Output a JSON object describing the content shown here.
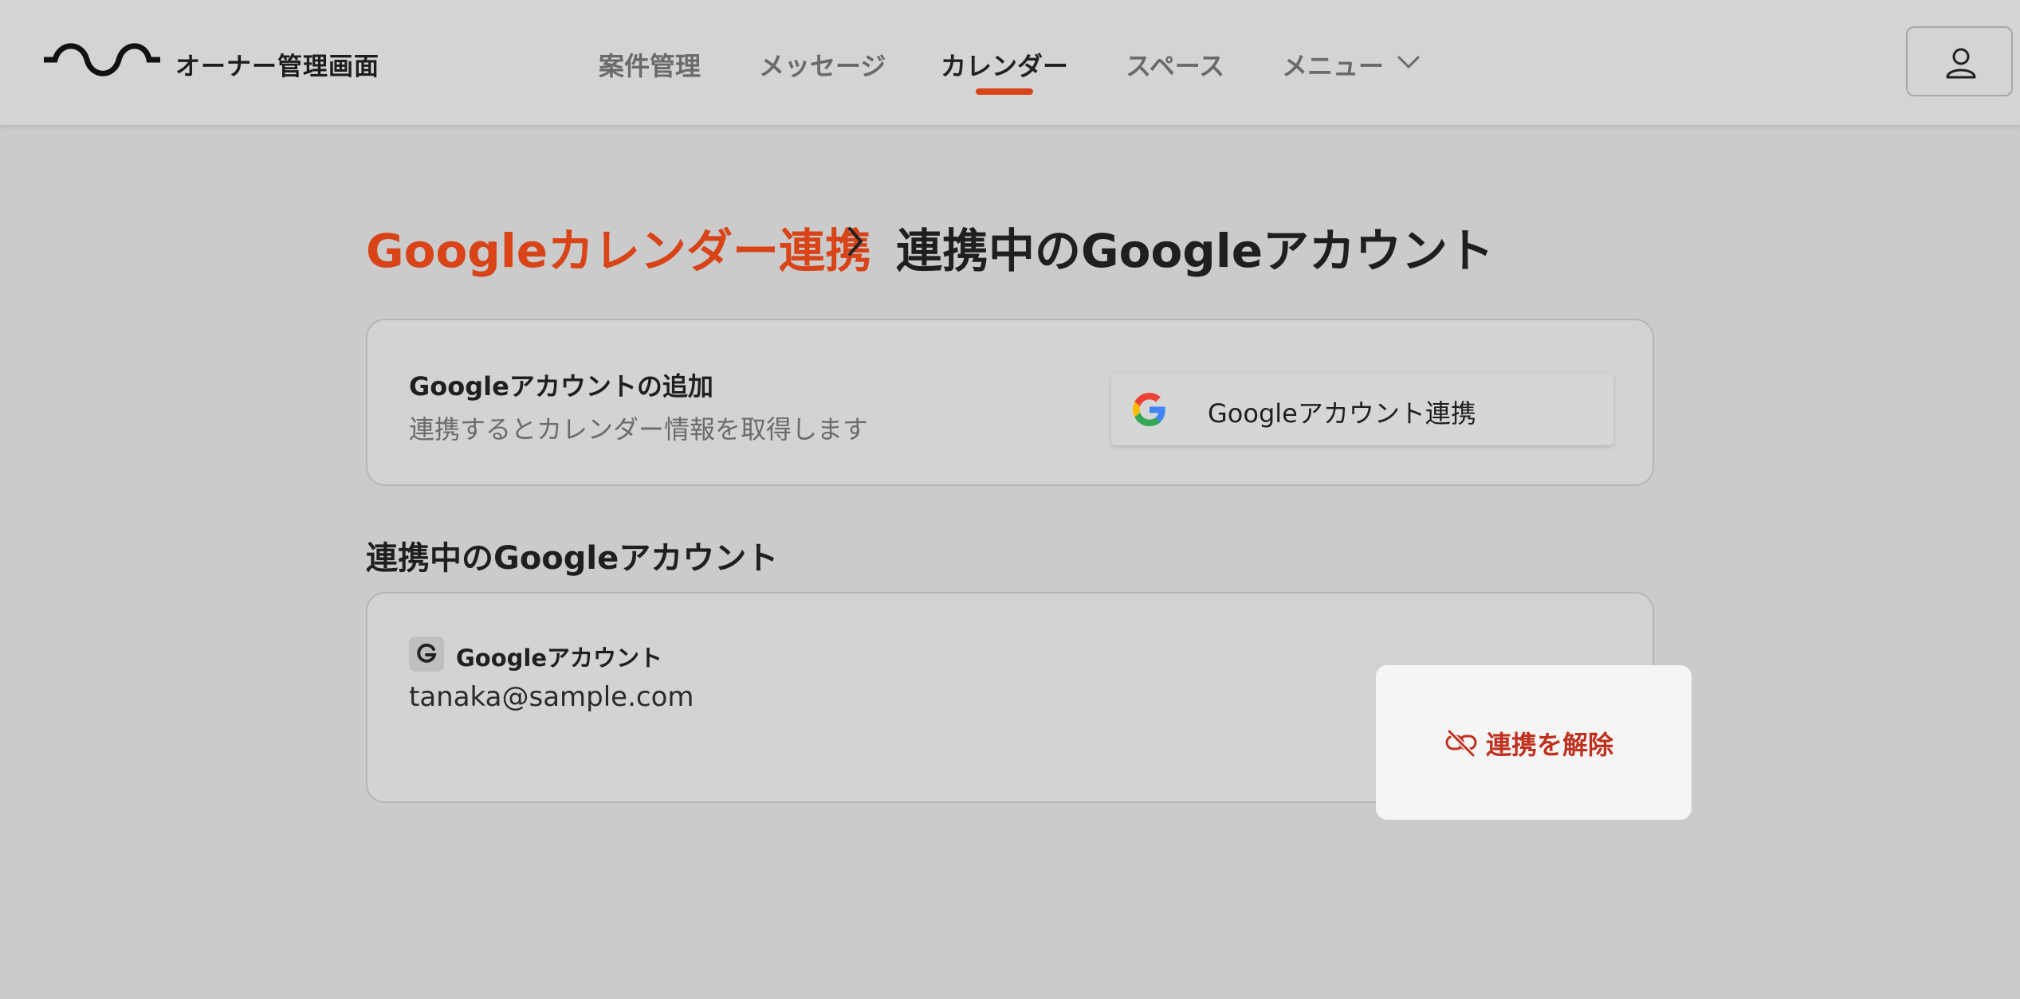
{
  "header": {
    "brand": "オーナー管理画面",
    "nav": [
      {
        "label": "案件管理"
      },
      {
        "label": "メッセージ"
      },
      {
        "label": "カレンダー",
        "active": true
      },
      {
        "label": "スペース"
      },
      {
        "label": "メニュー"
      }
    ]
  },
  "breadcrumb": {
    "parent": "Googleカレンダー連携",
    "current": "連携中のGoogleアカウント"
  },
  "add_card": {
    "title": "Googleアカウントの追加",
    "description": "連携するとカレンダー情報を取得します",
    "button_label": "Googleアカウント連携"
  },
  "linked_section": {
    "title": "連携中のGoogleアカウント",
    "account_label": "Googleアカウント",
    "email": "tanaka@sample.com",
    "unlink_label": "連携を解除"
  },
  "colors": {
    "accent": "#d84318",
    "danger": "#c0301e",
    "background": "#cbcbcb",
    "header_bg": "#d4d4d4"
  },
  "icons": [
    "logo-wave-icon",
    "chevron-down-icon",
    "user-icon",
    "chevron-right-icon",
    "google-g-icon",
    "unlink-icon"
  ]
}
